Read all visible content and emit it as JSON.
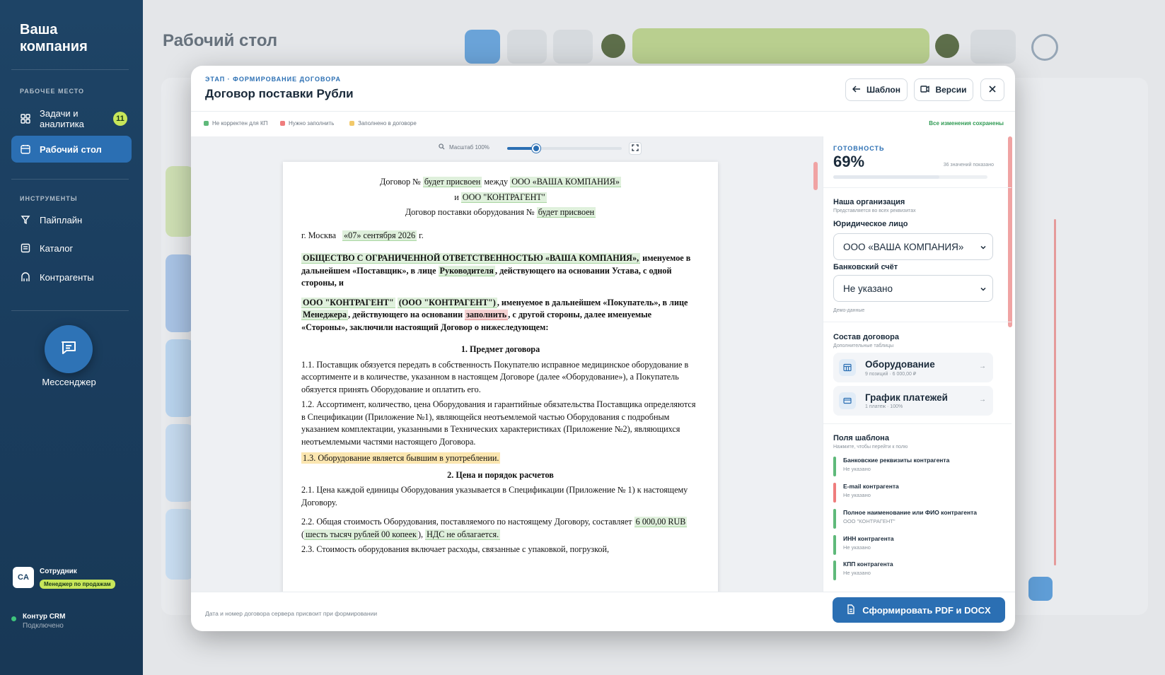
{
  "sidebar": {
    "brand": "Ваша компания",
    "section_work": "РАБОЧЕЕ МЕСТО",
    "items_work": [
      {
        "label": "Задачи и аналитика",
        "badge": "11"
      },
      {
        "label": "Рабочий стол"
      }
    ],
    "section_tools": "ИНСТРУМЕНТЫ",
    "items_tools": [
      {
        "label": "Пайплайн"
      },
      {
        "label": "Каталог"
      },
      {
        "label": "Контрагенты"
      }
    ],
    "messenger": "Мессенджер",
    "user": {
      "initials": "CA",
      "name": "Сотрудник",
      "role": "Менеджер по продажам"
    },
    "crm": {
      "name": "Контур CRM",
      "status": "Подключено"
    }
  },
  "background": {
    "title": "Рабочий стол"
  },
  "modal": {
    "stage": "ЭТАП · ФОРМИРОВАНИЕ ДОГОВОРА",
    "title": "Договор поставки Рубли",
    "btn_template": "Шаблон",
    "btn_versions": "Версии",
    "legend": [
      {
        "label": "Не корректен для КП",
        "color": "#5fb97a"
      },
      {
        "label": "Нужно заполнить",
        "color": "#ef7d7d"
      },
      {
        "label": "Заполнено в договоре",
        "color": "#f2c96a"
      }
    ],
    "saved": "Все изменения сохранены",
    "zoom_label": "Масштаб 100%",
    "zoom_fraction": 0.25,
    "footer_note": "Дата и номер договора сервера присвоит при формировании",
    "primary_btn": "Сформировать PDF и DOCX"
  },
  "doc": {
    "h_line1_pre": "Договор №",
    "h_num": "будет присвоен",
    "h_between": "между",
    "h_party1": "ООО «ВАША КОМПАНИЯ»",
    "h_and": "и",
    "h_party2": "ООО \"КОНТРАГЕНТ\"",
    "h_line3_pre": "Договор поставки оборудования №",
    "h_num2": "будет присвоен",
    "city": "г. Москва",
    "date": "«07» сентября 2026",
    "date_suffix": "г.",
    "p1_bold": "ОБЩЕСТВО С ОГРАНИЧЕННОЙ ОТВЕТСТВЕННОСТЬЮ «ВАША КОМПАНИЯ»,",
    "p1_mid": "именуемое в дальнейшем «Поставщик», в лице",
    "p1_role": "Руководителя",
    "p1_end": ", действующего на основании Устава, с одной стороны, и",
    "p2_party": "ООО \"КОНТРАГЕНТ\"",
    "p2_party_paren": "(ООО \"КОНТРАГЕНТ\")",
    "p2_mid": ", именуемое в дальнейшем «Покупатель», в лице",
    "p2_role": "Менеджера",
    "p2_basis": ", действующего на основании",
    "p2_fill": "заполнить",
    "p2_end": ", с другой стороны, далее именуемые «Стороны», заключили настоящий Договор о нижеследующем:",
    "s1_title": "1. Предмет договора",
    "s1_1": "1.1. Поставщик обязуется передать в собственность Покупателю исправное медицинское оборудование в ассортименте и в количестве, указанном в настоящем Договоре (далее «Оборудование»), а Покупатель обязуется принять Оборудование и оплатить его.",
    "s1_2": "1.2. Ассортимент, количество, цена Оборудования и гарантийные обязательства Поставщика определяются в Спецификации (Приложение №1), являющейся неотъемлемой частью Оборудования с подробным указанием комплектации, указанными в Технических характеристиках (Приложение №2), являющихся неотъемлемыми частями настоящего Договора.",
    "s1_3": "1.3. Оборудование является бывшим в употреблении.",
    "s2_title": "2. Цена и порядок расчетов",
    "s2_1": "2.1. Цена каждой единицы Оборудования указывается в Спецификации (Приложение № 1) к настоящему Договору.",
    "s2_2_pre": "2.2. Общая стоимость Оборудования, поставляемого по настоящему Договору, составляет",
    "s2_2_sum": "6 000,00 RUB",
    "s2_2_words": "шесть тысяч рублей 00 копеек",
    "s2_2_vat": "НДС не облагается.",
    "s2_3": "2.3. Стоимость оборудования включает расходы, связанные с упаковкой, погрузкой,"
  },
  "right": {
    "ready_label": "ГОТОВНОСТЬ",
    "ready_value": "69%",
    "ready_fraction": 0.69,
    "ready_note": "36 значений показано",
    "org_title": "Наша организация",
    "org_sub": "Представляется во всех реквизитах",
    "legal_label": "Юридическое лицо",
    "legal_value": "ООО «ВАША КОМПАНИЯ»",
    "bank_label": "Банковский счёт",
    "bank_value": "Не указано",
    "demo": "Демо-данные",
    "comp_title": "Состав договора",
    "comp_sub": "Дополнительные таблицы",
    "comp_items": [
      {
        "title": "Оборудование",
        "sub": "9 позиций · 6 000,00 ₽"
      },
      {
        "title": "График платежей",
        "sub": "1 платеж · 100%"
      }
    ],
    "fields_title": "Поля шаблона",
    "fields_sub": "Нажмите, чтобы перейти к полю",
    "fields": [
      {
        "name": "Банковские реквизиты контрагента",
        "value": "Не указано",
        "color": "#5fb97a"
      },
      {
        "name": "E-mail контрагента",
        "value": "Не указано",
        "color": "#ef7d7d"
      },
      {
        "name": "Полное наименование или ФИО контрагента",
        "value": "ООО \"КОНТРАГЕНТ\"",
        "color": "#5fb97a"
      },
      {
        "name": "ИНН контрагента",
        "value": "Не указано",
        "color": "#5fb97a"
      },
      {
        "name": "КПП контрагента",
        "value": "Не указано",
        "color": "#5fb97a"
      }
    ]
  }
}
